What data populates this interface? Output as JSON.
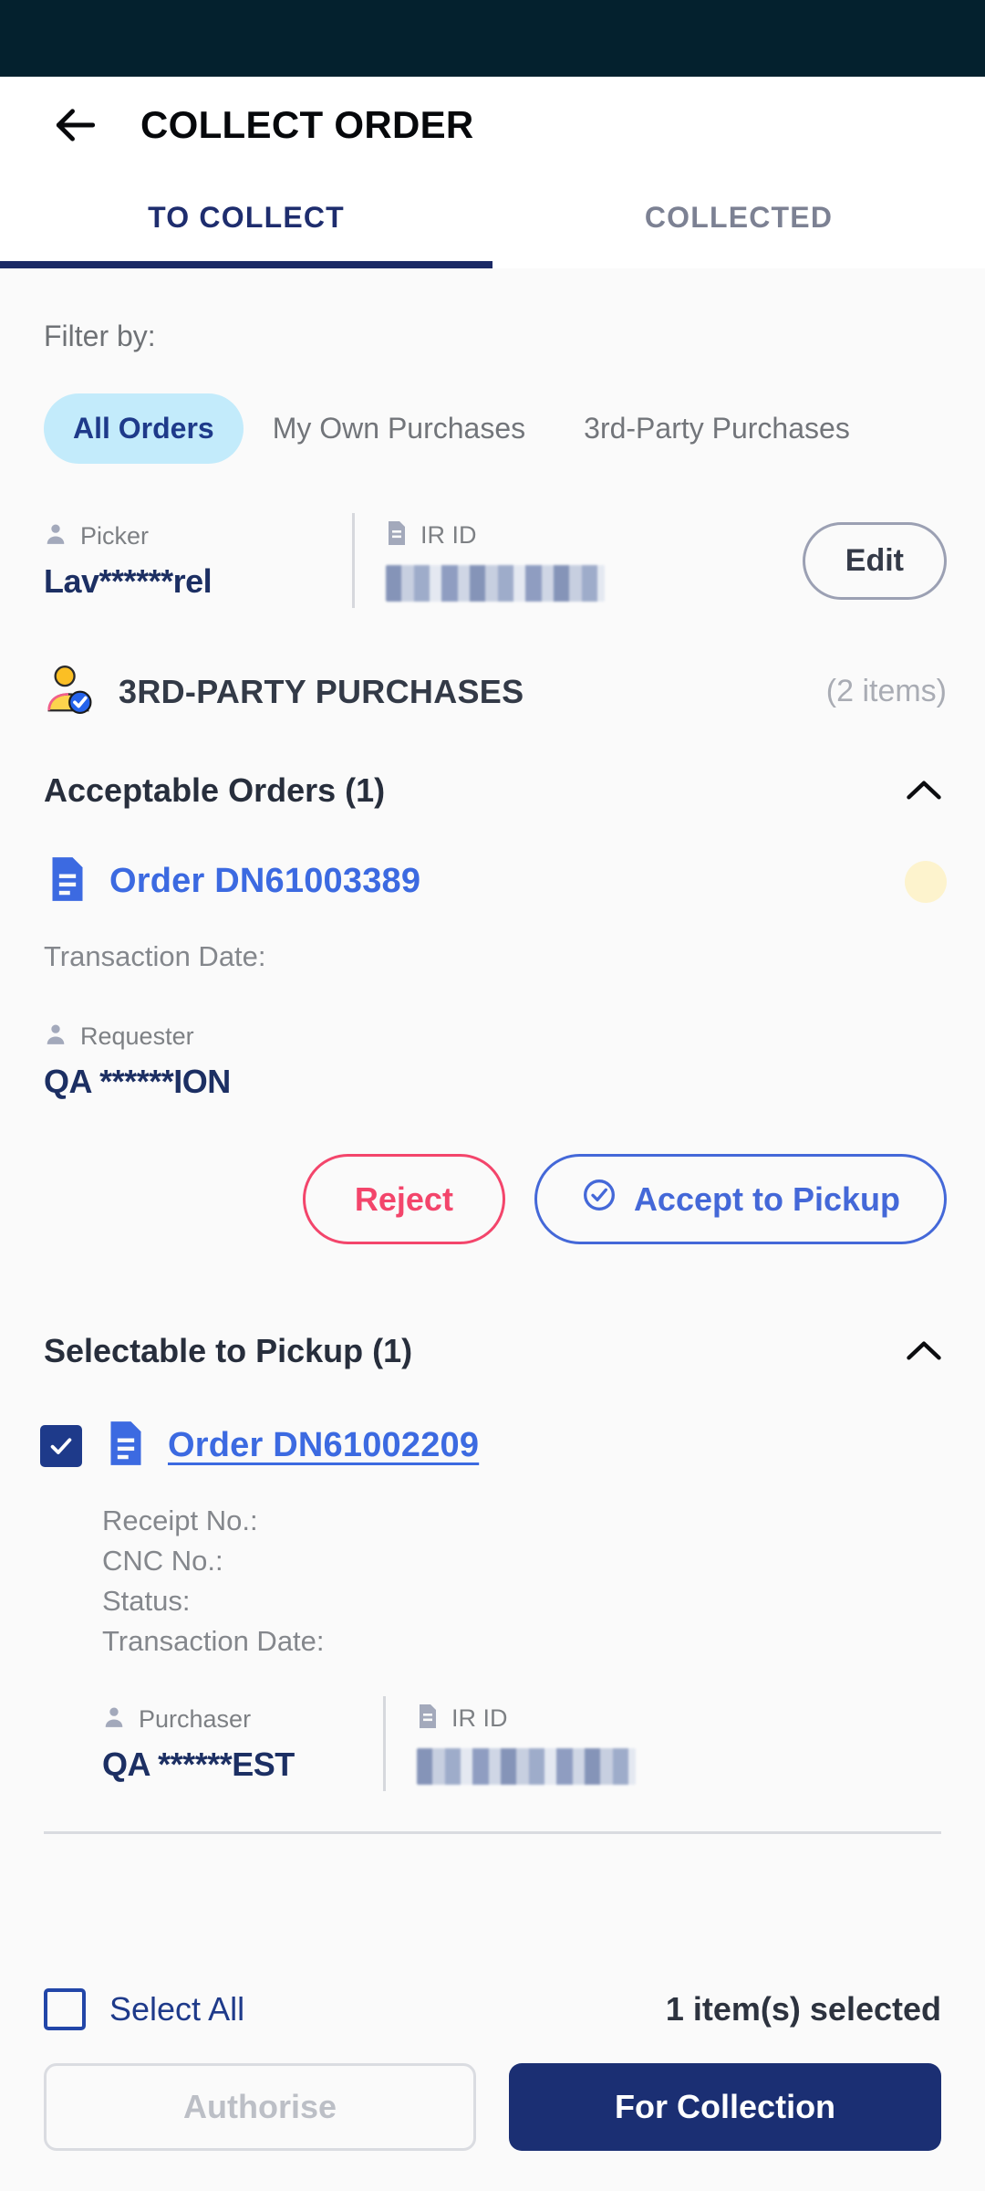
{
  "app": {
    "title": "COLLECT ORDER",
    "back_icon": "arrow-left-icon"
  },
  "tabs": [
    {
      "label": "TO COLLECT",
      "active": true
    },
    {
      "label": "COLLECTED",
      "active": false
    }
  ],
  "filter": {
    "label": "Filter by:",
    "chips": [
      {
        "label": "All Orders",
        "active": true
      },
      {
        "label": "My Own Purchases",
        "active": false
      },
      {
        "label": "3rd-Party Purchases",
        "active": false
      }
    ]
  },
  "picker_bar": {
    "picker_label": "Picker",
    "picker_value": "Lav******rel",
    "ir_id_label": "IR ID",
    "ir_id_value": "",
    "edit_label": "Edit"
  },
  "group": {
    "title": "3RD-PARTY PURCHASES",
    "count": "(2 items)",
    "icon": "third-party-user-verified-icon"
  },
  "acceptable": {
    "title": "Acceptable Orders (1)",
    "order": {
      "link": "Order DN61003389",
      "transaction_date": "Transaction Date:",
      "requester_label": "Requester",
      "requester_value": "QA ******ION"
    },
    "reject_label": "Reject",
    "accept_label": "Accept to Pickup"
  },
  "selectable": {
    "title": "Selectable to Pickup (1)",
    "order": {
      "link": "Order DN61002209",
      "details": [
        "Receipt No.:",
        "CNC No.:",
        "Status:",
        "Transaction Date:"
      ],
      "purchaser_label": "Purchaser",
      "purchaser_value": "QA ******EST",
      "ir_id_label": "IR ID",
      "ir_id_value": ""
    }
  },
  "bottom": {
    "select_all_label": "Select All",
    "selected_count": "1 item(s) selected",
    "authorise_label": "Authorise",
    "for_collection_label": "For Collection"
  },
  "colors": {
    "status_bar": "#04212e",
    "tab_active": "#1b2a66",
    "chip_active_bg": "#c3ebfb",
    "chip_active_text": "#1e3a8a",
    "order_link": "#3c6ae1",
    "reject": "#f3456b",
    "accept": "#4468d8",
    "primary_button": "#1b2f73",
    "badge_yellow": "#fdf3cd"
  }
}
